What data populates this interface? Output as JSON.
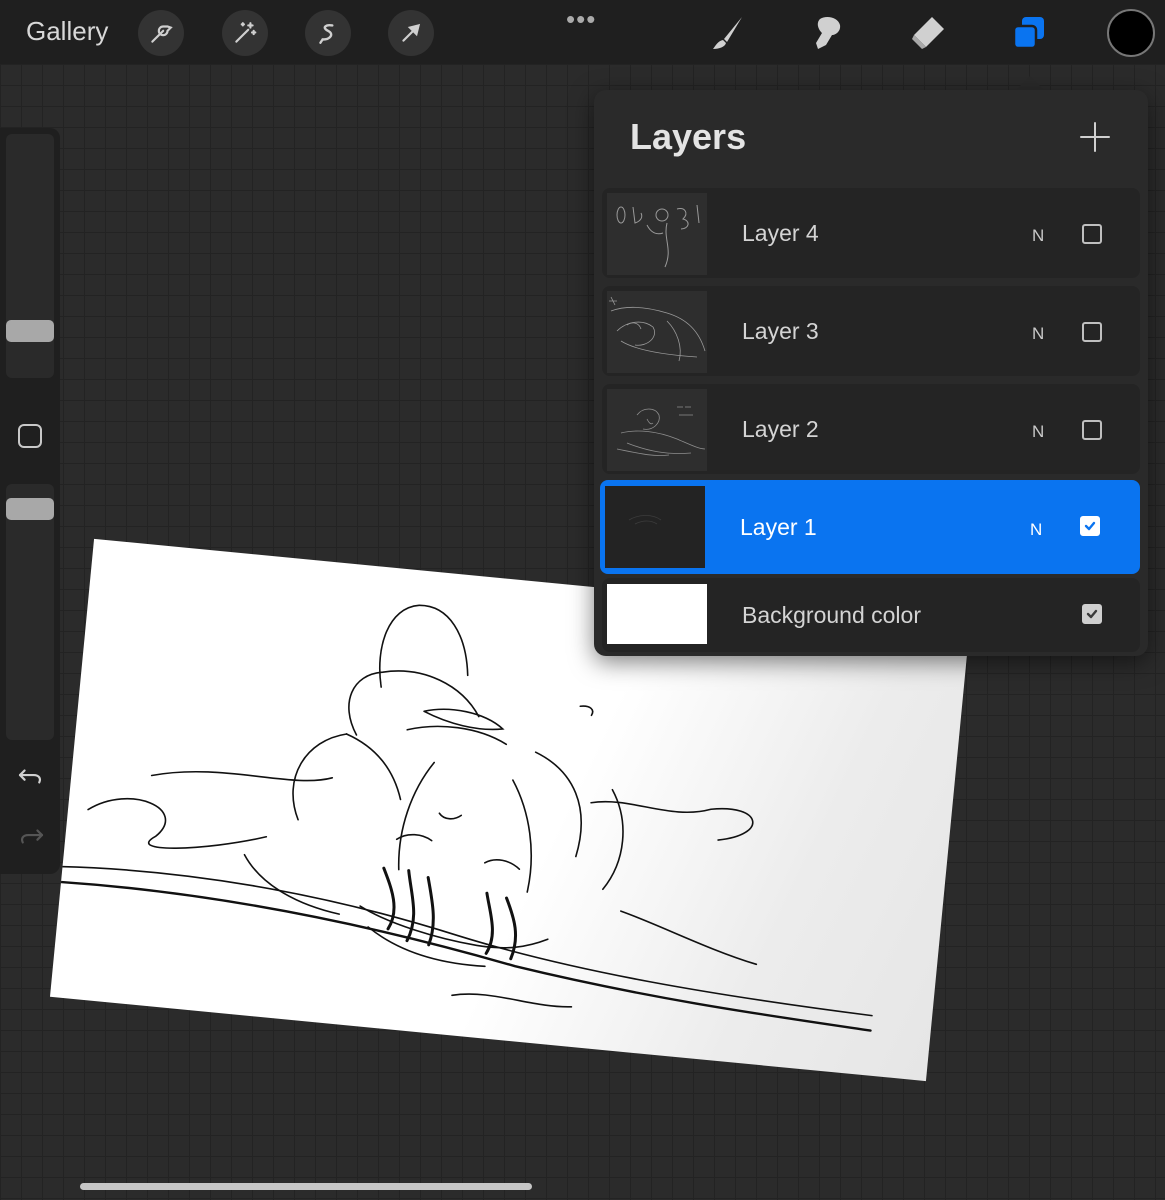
{
  "topbar": {
    "gallery_label": "Gallery",
    "left_tools": [
      "wrench-icon",
      "magic-wand-icon",
      "selection-icon",
      "transform-arrow-icon"
    ],
    "more_label": "•••",
    "right_tools": [
      "brush-icon",
      "smudge-icon",
      "eraser-icon",
      "layers-icon"
    ],
    "current_color": "#000000",
    "accent_color": "#0a74f0"
  },
  "sidebar": {
    "brush_size_level": 0.22,
    "opacity_level": 0.78,
    "modify_icon": "square-icon",
    "undo_icon": "undo-icon",
    "redo_icon": "redo-icon"
  },
  "layers_panel": {
    "title": "Layers",
    "add_icon": "plus-icon",
    "layers": [
      {
        "name": "Layer 4",
        "blend": "N",
        "visible": false,
        "selected": false
      },
      {
        "name": "Layer 3",
        "blend": "N",
        "visible": false,
        "selected": false
      },
      {
        "name": "Layer 2",
        "blend": "N",
        "visible": false,
        "selected": false
      },
      {
        "name": "Layer 1",
        "blend": "N",
        "visible": true,
        "selected": true
      }
    ],
    "background": {
      "name": "Background color",
      "visible": true,
      "color": "#ffffff"
    }
  }
}
